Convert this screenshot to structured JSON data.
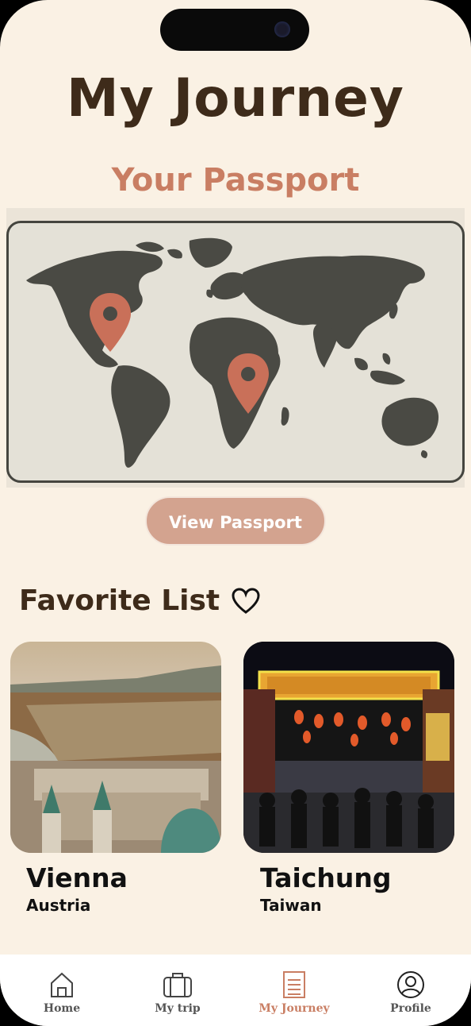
{
  "header": {
    "title": "My Journey",
    "subtitle": "Your Passport"
  },
  "passport": {
    "button_label": "View Passport"
  },
  "favorites": {
    "heading": "Favorite List",
    "items": [
      {
        "city": "Vienna",
        "country": "Austria"
      },
      {
        "city": "Taichung",
        "country": "Taiwan"
      }
    ]
  },
  "tabs": [
    {
      "label": "Home",
      "icon": "home-icon"
    },
    {
      "label": "My trip",
      "icon": "suitcase-icon"
    },
    {
      "label": "My Journey",
      "icon": "journal-icon"
    },
    {
      "label": "Profile",
      "icon": "profile-icon"
    }
  ],
  "colors": {
    "background": "#faf1e4",
    "title": "#3e2b1a",
    "accent": "#c97e63",
    "button": "#d3a38f",
    "map_land": "#4a4a44"
  }
}
